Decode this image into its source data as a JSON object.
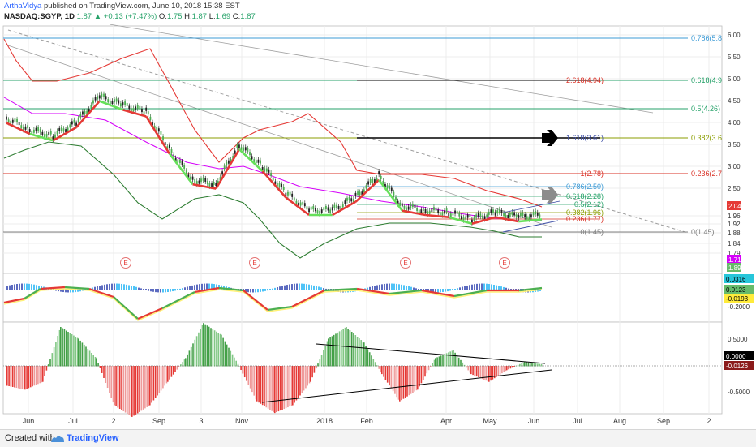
{
  "header": {
    "author": "ArthaVidya",
    "published": "published on TradingView.com, June 10, 2018 15:38 EST",
    "symbol": "NASDAQ:SGYP, 1D",
    "last": "1.87",
    "change": "+0.13 (+7.47%)",
    "change_arrow": "▲",
    "ohlc": {
      "o_label": "O:",
      "o": "1.75",
      "h_label": "H:",
      "h": "1.87",
      "l_label": "L:",
      "l": "1.69",
      "c_label": "C:",
      "c": "1.87"
    }
  },
  "footer": {
    "created_with": "Created with",
    "brand": "TradingView"
  },
  "colors": {
    "up": "#26a269",
    "down": "#d93025",
    "fib": "#3d9bd6",
    "grid": "#e4e4e4"
  },
  "chart_data": [
    {
      "type": "line",
      "panel": "price",
      "x": [
        "Jun",
        "Jul",
        "2",
        "Sep",
        "3",
        "Nov",
        "2018",
        "Feb",
        "Apr",
        "May",
        "Jun",
        "Jul",
        "Aug",
        "Sep",
        "2"
      ],
      "yticks": [
        "6.00",
        "5.50",
        "5.00",
        "4.50",
        "4.00",
        "3.50",
        "3.00",
        "2.50",
        "1.96",
        "1.92",
        "1.88",
        "1.84",
        "1.79"
      ],
      "series": [
        {
          "values": [
            4.1,
            3.85,
            3.7,
            4.0,
            4.6,
            4.4,
            4.25,
            3.4,
            2.7,
            2.6,
            3.5,
            3.0,
            2.4,
            2.0,
            2.0,
            2.3,
            2.8,
            2.1,
            2.0,
            1.95,
            1.8,
            1.95,
            1.85,
            1.9
          ]
        }
      ],
      "fib_right": [
        {
          "label": "0.786(5.8",
          "color": "#3d9bd6"
        },
        {
          "label": "0.618(4.9",
          "color": "#26a269"
        },
        {
          "label": "0.5(4.26)",
          "color": "#26a269"
        },
        {
          "label": "0.382(3.6",
          "color": "#8b9e00"
        },
        {
          "label": "0.236(2.7",
          "color": "#d93025"
        },
        {
          "label": "0(1.45)",
          "color": "#808080"
        }
      ],
      "fib_mid": [
        {
          "label": "2.618(4.94)",
          "color": "#d93025"
        },
        {
          "label": "1.618(3.61)",
          "color": "#3d4ea6"
        },
        {
          "label": "1(2.78)",
          "color": "#d93025"
        },
        {
          "label": "0.786(2.50)",
          "color": "#3d9bd6"
        },
        {
          "label": "0.618(2.28)",
          "color": "#26a269"
        },
        {
          "label": "0.5(2.12)",
          "color": "#26a269"
        },
        {
          "label": "0.382(1.96)",
          "color": "#8b9e00"
        },
        {
          "label": "0.236(1.77)",
          "color": "#d93025"
        },
        {
          "label": "0(1.45)",
          "color": "#808080"
        }
      ],
      "price_tags": [
        {
          "label": "2.04",
          "color": "#e53935"
        },
        {
          "label": "1.71",
          "color": "#d500f9"
        },
        {
          "label": "1.89",
          "color": "#66bb6a"
        }
      ],
      "event_marker": "E"
    },
    {
      "type": "line",
      "panel": "oscillator",
      "yticks": [
        "-0.2000"
      ],
      "tags": [
        {
          "label": "0.0316",
          "color": "#26c6da"
        },
        {
          "label": "0.0123",
          "color": "#66bb6a"
        },
        {
          "label": "-0.0193",
          "color": "#ffeb3b"
        }
      ]
    },
    {
      "type": "bar",
      "panel": "histogram",
      "yticks": [
        "0.5000",
        "-0.5000"
      ],
      "values": [
        -0.25,
        -0.3,
        -0.2,
        0.5,
        0.35,
        0.1,
        -0.5,
        -0.65,
        -0.5,
        -0.2,
        0.1,
        0.55,
        0.4,
        0.0,
        -0.45,
        -0.6,
        -0.5,
        -0.2,
        0.35,
        0.5,
        0.3,
        -0.1,
        -0.45,
        -0.3,
        0.1,
        0.2,
        -0.1,
        -0.2,
        -0.05,
        0.05,
        0.02
      ],
      "tags": [
        {
          "label": "0.0000",
          "color": "#000000"
        },
        {
          "label": "-0.0126",
          "color": "#8b1a1a"
        }
      ]
    }
  ]
}
